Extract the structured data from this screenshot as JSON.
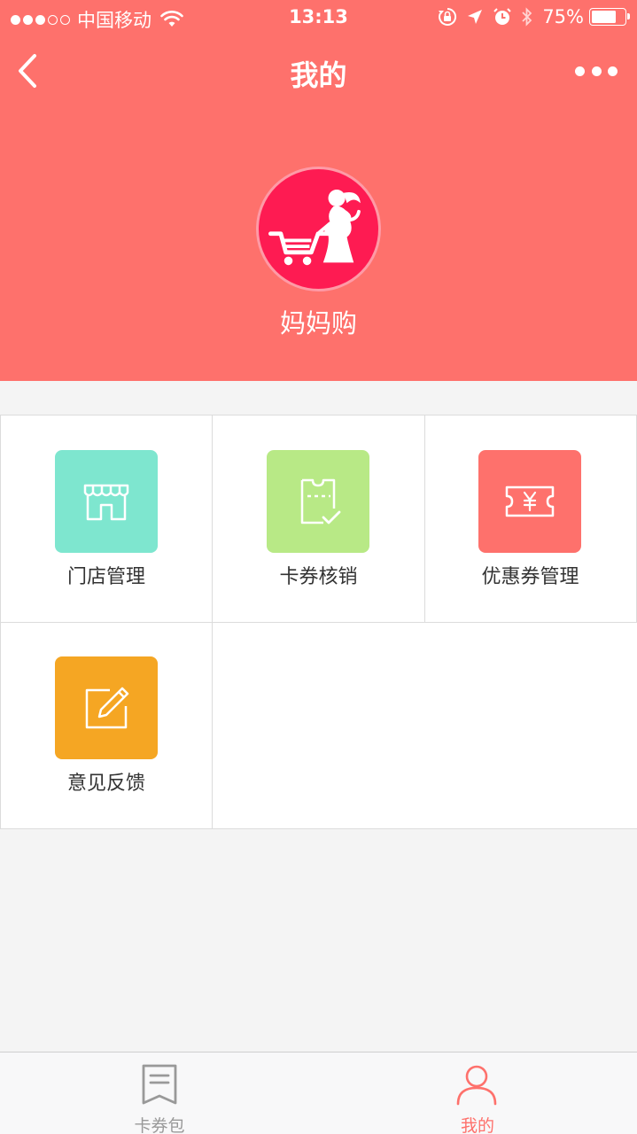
{
  "status_bar": {
    "carrier": "中国移动",
    "time": "13:13",
    "battery_percent": "75%",
    "battery_level": 0.75,
    "signal_bars_filled": 3,
    "signal_bars_total": 5
  },
  "nav": {
    "title": "我的",
    "back_icon": "chevron-left-icon",
    "more_icon": "more-dots-icon"
  },
  "profile": {
    "name": "妈妈购",
    "avatar_icon": "mother-shopping-cart-logo"
  },
  "menu": [
    {
      "id": "store-management",
      "label": "门店管理",
      "icon": "storefront-icon",
      "color": "#7ee6cf"
    },
    {
      "id": "coupon-verify",
      "label": "卡券核销",
      "icon": "ticket-check-icon",
      "color": "#b8e986"
    },
    {
      "id": "coupon-management",
      "label": "优惠券管理",
      "icon": "yen-ticket-icon",
      "color": "#fe716c"
    },
    {
      "id": "feedback",
      "label": "意见反馈",
      "icon": "edit-note-icon",
      "color": "#f5a623"
    }
  ],
  "tabs": [
    {
      "id": "coupon-wallet",
      "label": "卡券包",
      "icon": "bookmark-list-icon",
      "active": false
    },
    {
      "id": "mine",
      "label": "我的",
      "icon": "user-icon",
      "active": true
    }
  ],
  "colors": {
    "brand": "#fe716c",
    "avatar_bg": "#fe1b52",
    "active_tab": "#fe716c",
    "inactive_tab": "#999999"
  }
}
